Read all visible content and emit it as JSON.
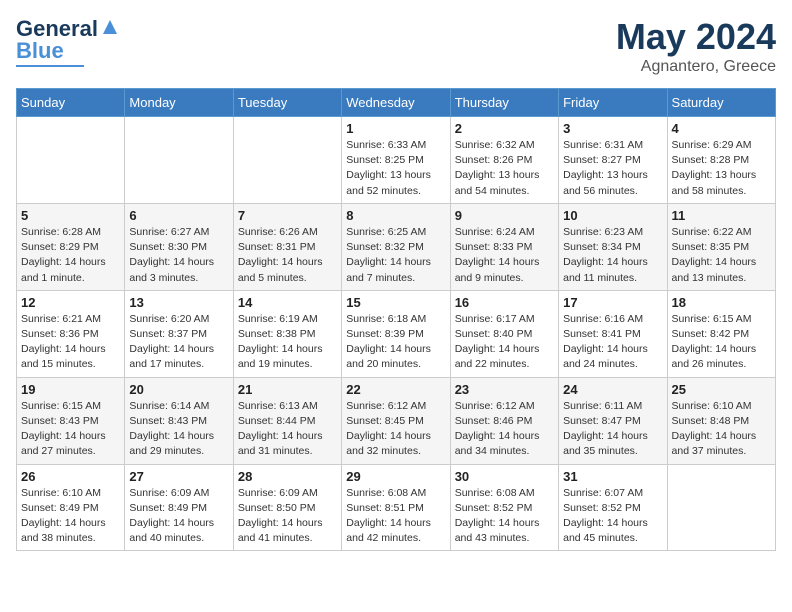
{
  "header": {
    "logo_general": "General",
    "logo_blue": "Blue",
    "title": "May 2024",
    "location": "Agnantero, Greece"
  },
  "weekdays": [
    "Sunday",
    "Monday",
    "Tuesday",
    "Wednesday",
    "Thursday",
    "Friday",
    "Saturday"
  ],
  "weeks": [
    [
      {
        "day": "",
        "info": ""
      },
      {
        "day": "",
        "info": ""
      },
      {
        "day": "",
        "info": ""
      },
      {
        "day": "1",
        "info": "Sunrise: 6:33 AM\nSunset: 8:25 PM\nDaylight: 13 hours\nand 52 minutes."
      },
      {
        "day": "2",
        "info": "Sunrise: 6:32 AM\nSunset: 8:26 PM\nDaylight: 13 hours\nand 54 minutes."
      },
      {
        "day": "3",
        "info": "Sunrise: 6:31 AM\nSunset: 8:27 PM\nDaylight: 13 hours\nand 56 minutes."
      },
      {
        "day": "4",
        "info": "Sunrise: 6:29 AM\nSunset: 8:28 PM\nDaylight: 13 hours\nand 58 minutes."
      }
    ],
    [
      {
        "day": "5",
        "info": "Sunrise: 6:28 AM\nSunset: 8:29 PM\nDaylight: 14 hours\nand 1 minute."
      },
      {
        "day": "6",
        "info": "Sunrise: 6:27 AM\nSunset: 8:30 PM\nDaylight: 14 hours\nand 3 minutes."
      },
      {
        "day": "7",
        "info": "Sunrise: 6:26 AM\nSunset: 8:31 PM\nDaylight: 14 hours\nand 5 minutes."
      },
      {
        "day": "8",
        "info": "Sunrise: 6:25 AM\nSunset: 8:32 PM\nDaylight: 14 hours\nand 7 minutes."
      },
      {
        "day": "9",
        "info": "Sunrise: 6:24 AM\nSunset: 8:33 PM\nDaylight: 14 hours\nand 9 minutes."
      },
      {
        "day": "10",
        "info": "Sunrise: 6:23 AM\nSunset: 8:34 PM\nDaylight: 14 hours\nand 11 minutes."
      },
      {
        "day": "11",
        "info": "Sunrise: 6:22 AM\nSunset: 8:35 PM\nDaylight: 14 hours\nand 13 minutes."
      }
    ],
    [
      {
        "day": "12",
        "info": "Sunrise: 6:21 AM\nSunset: 8:36 PM\nDaylight: 14 hours\nand 15 minutes."
      },
      {
        "day": "13",
        "info": "Sunrise: 6:20 AM\nSunset: 8:37 PM\nDaylight: 14 hours\nand 17 minutes."
      },
      {
        "day": "14",
        "info": "Sunrise: 6:19 AM\nSunset: 8:38 PM\nDaylight: 14 hours\nand 19 minutes."
      },
      {
        "day": "15",
        "info": "Sunrise: 6:18 AM\nSunset: 8:39 PM\nDaylight: 14 hours\nand 20 minutes."
      },
      {
        "day": "16",
        "info": "Sunrise: 6:17 AM\nSunset: 8:40 PM\nDaylight: 14 hours\nand 22 minutes."
      },
      {
        "day": "17",
        "info": "Sunrise: 6:16 AM\nSunset: 8:41 PM\nDaylight: 14 hours\nand 24 minutes."
      },
      {
        "day": "18",
        "info": "Sunrise: 6:15 AM\nSunset: 8:42 PM\nDaylight: 14 hours\nand 26 minutes."
      }
    ],
    [
      {
        "day": "19",
        "info": "Sunrise: 6:15 AM\nSunset: 8:43 PM\nDaylight: 14 hours\nand 27 minutes."
      },
      {
        "day": "20",
        "info": "Sunrise: 6:14 AM\nSunset: 8:43 PM\nDaylight: 14 hours\nand 29 minutes."
      },
      {
        "day": "21",
        "info": "Sunrise: 6:13 AM\nSunset: 8:44 PM\nDaylight: 14 hours\nand 31 minutes."
      },
      {
        "day": "22",
        "info": "Sunrise: 6:12 AM\nSunset: 8:45 PM\nDaylight: 14 hours\nand 32 minutes."
      },
      {
        "day": "23",
        "info": "Sunrise: 6:12 AM\nSunset: 8:46 PM\nDaylight: 14 hours\nand 34 minutes."
      },
      {
        "day": "24",
        "info": "Sunrise: 6:11 AM\nSunset: 8:47 PM\nDaylight: 14 hours\nand 35 minutes."
      },
      {
        "day": "25",
        "info": "Sunrise: 6:10 AM\nSunset: 8:48 PM\nDaylight: 14 hours\nand 37 minutes."
      }
    ],
    [
      {
        "day": "26",
        "info": "Sunrise: 6:10 AM\nSunset: 8:49 PM\nDaylight: 14 hours\nand 38 minutes."
      },
      {
        "day": "27",
        "info": "Sunrise: 6:09 AM\nSunset: 8:49 PM\nDaylight: 14 hours\nand 40 minutes."
      },
      {
        "day": "28",
        "info": "Sunrise: 6:09 AM\nSunset: 8:50 PM\nDaylight: 14 hours\nand 41 minutes."
      },
      {
        "day": "29",
        "info": "Sunrise: 6:08 AM\nSunset: 8:51 PM\nDaylight: 14 hours\nand 42 minutes."
      },
      {
        "day": "30",
        "info": "Sunrise: 6:08 AM\nSunset: 8:52 PM\nDaylight: 14 hours\nand 43 minutes."
      },
      {
        "day": "31",
        "info": "Sunrise: 6:07 AM\nSunset: 8:52 PM\nDaylight: 14 hours\nand 45 minutes."
      },
      {
        "day": "",
        "info": ""
      }
    ]
  ]
}
